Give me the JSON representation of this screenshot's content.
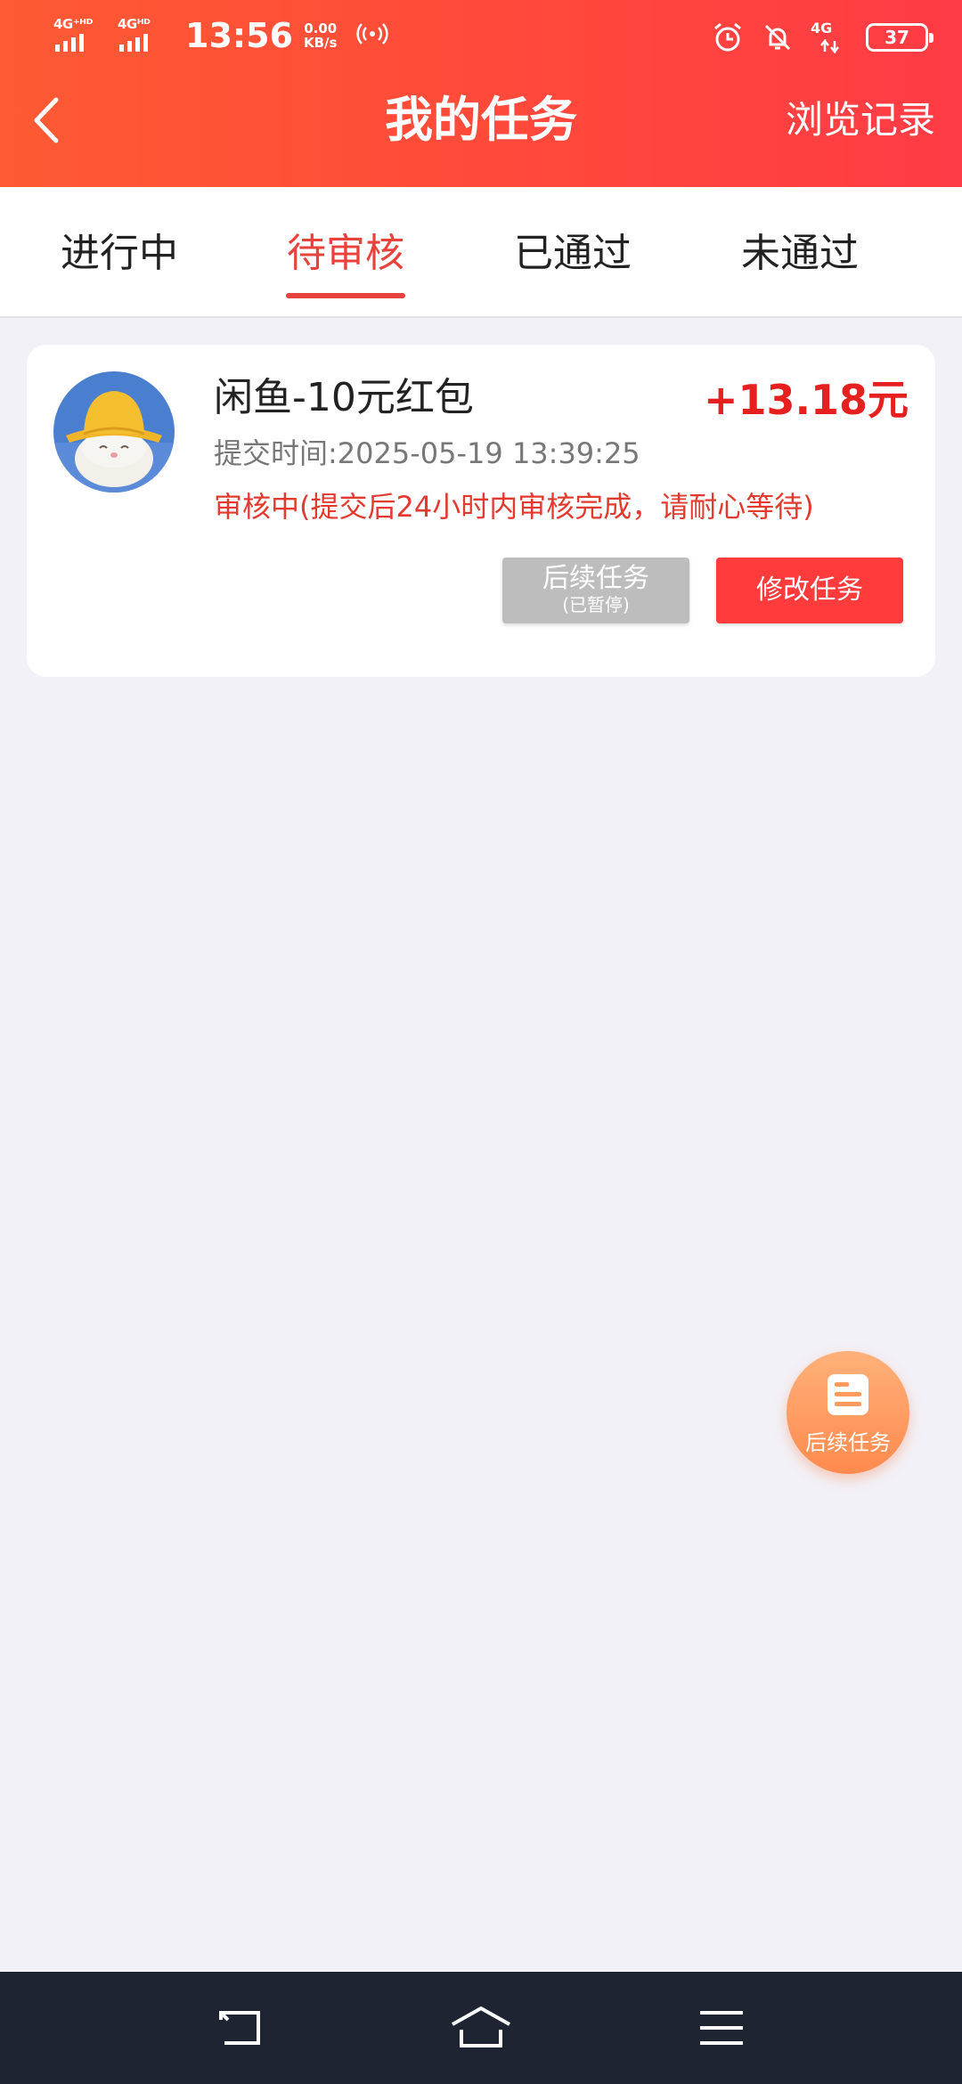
{
  "status_bar": {
    "network_1": "4G⁺ᴴᴰ",
    "network_2": "4Gᴴᴰ",
    "time": "13:56",
    "speed_value": "0.00",
    "speed_unit": "KB/s",
    "network_right": "4G",
    "battery": "37"
  },
  "header": {
    "title": "我的任务",
    "history_label": "浏览记录"
  },
  "tabs": [
    {
      "label": "进行中",
      "active": false
    },
    {
      "label": "待审核",
      "active": true
    },
    {
      "label": "已通过",
      "active": false
    },
    {
      "label": "未通过",
      "active": false
    }
  ],
  "task": {
    "title": "闲鱼-10元红包",
    "reward": "+13.18元",
    "submit_time_label": "提交时间:",
    "submit_time": "2025-05-19 13:39:25",
    "status_text": "审核中(提交后24小时内审核完成，请耐心等待)",
    "followup_label": "后续任务",
    "followup_sub": "(已暂停)",
    "modify_label": "修改任务"
  },
  "fab": {
    "label": "后续任务"
  },
  "colors": {
    "header_start": "#ff5a33",
    "header_end": "#ff3b45",
    "accent": "#e8423c",
    "reward": "#e61f1f",
    "fab": "#ff9a5e",
    "nav_bar": "#1f2433"
  }
}
